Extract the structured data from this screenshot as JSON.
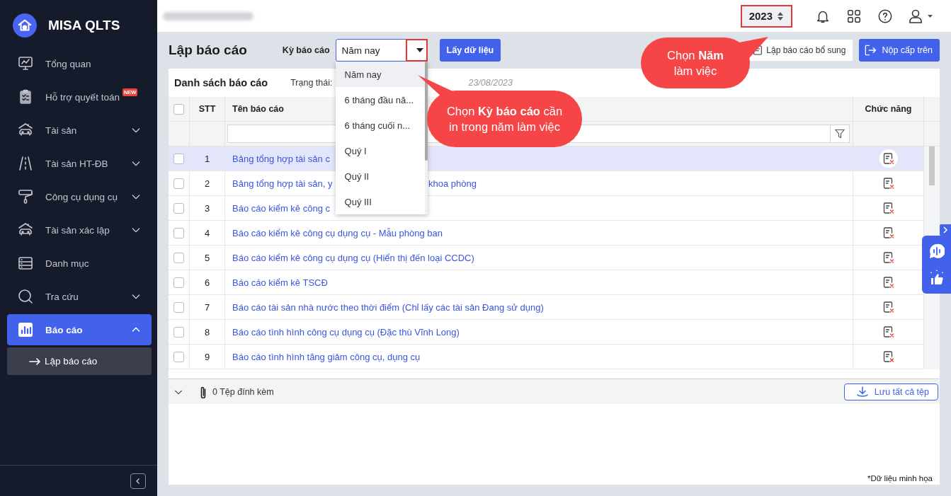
{
  "sidebar": {
    "app_name": "MISA QLTS",
    "items": [
      {
        "label": "Tổng quan",
        "selected": false
      },
      {
        "label": "Hỗ trợ quyết toán",
        "badge": "NEW",
        "selected": false
      },
      {
        "label": "Tài sản",
        "selected": false,
        "expanded": false
      },
      {
        "label": "Tài sản HT-ĐB",
        "selected": false,
        "expanded": false
      },
      {
        "label": "Công cụ dụng cụ",
        "selected": false,
        "expanded": false
      },
      {
        "label": "Tài sản xác lập",
        "selected": false,
        "expanded": false
      },
      {
        "label": "Danh mục",
        "selected": false
      },
      {
        "label": "Tra cứu",
        "selected": false,
        "expanded": false
      },
      {
        "label": "Báo cáo",
        "selected": true,
        "expanded": true,
        "children": [
          {
            "label": "Lập báo cáo",
            "selected": true
          }
        ]
      }
    ]
  },
  "header": {
    "year": "2023"
  },
  "page": {
    "title": "Lập báo cáo",
    "period_label": "Kỳ báo cáo",
    "period_value": "Năm nay",
    "fetch_button": "Lấy dữ liệu",
    "supplement_button": "Lập báo cáo bổ sung",
    "submit_button": "Nộp cấp trên"
  },
  "period_dropdown": {
    "options": [
      {
        "label": "Năm nay",
        "selected": true
      },
      {
        "label": "6 tháng đầu nă...",
        "selected": false
      },
      {
        "label": "6 tháng cuối n...",
        "selected": false
      },
      {
        "label": "Quý I",
        "selected": false
      },
      {
        "label": "Quý II",
        "selected": false
      },
      {
        "label": "Quý III",
        "selected": false
      }
    ]
  },
  "report_list": {
    "title": "Danh sách báo cáo",
    "status_label": "Trạng thái:",
    "date": "23/08/2023",
    "columns": [
      "STT",
      "Tên báo cáo",
      "Chức năng"
    ],
    "header_checked": false,
    "rows": [
      {
        "stt": "1",
        "name": "Bảng tổng hợp tài sản c",
        "checked": false,
        "selected": true
      },
      {
        "stt": "2",
        "name": "Bảng tổng hợp tài sản, y",
        "name_after_overlay": "khoa phòng",
        "checked": false,
        "selected": false
      },
      {
        "stt": "3",
        "name": "Báo cáo kiểm kê công c",
        "checked": false,
        "selected": false
      },
      {
        "stt": "4",
        "name": "Báo cáo kiểm kê công cụ dụng cụ - Mẫu phòng ban",
        "checked": false,
        "selected": false
      },
      {
        "stt": "5",
        "name": "Báo cáo kiểm kê công cụ dụng cụ (Hiển thị đến loại CCDC)",
        "checked": false,
        "selected": false
      },
      {
        "stt": "6",
        "name": "Báo cáo kiểm kê TSCĐ",
        "checked": false,
        "selected": false
      },
      {
        "stt": "7",
        "name": "Báo cáo tài sản nhà nước theo thời điểm (Chỉ lấy các tài sản Đang sử dụng)",
        "checked": false,
        "selected": false
      },
      {
        "stt": "8",
        "name": "Báo cáo tình hình công cụ dụng cụ (Đặc thù Vĩnh Long)",
        "checked": false,
        "selected": false
      },
      {
        "stt": "9",
        "name": "Báo cáo tình hình tăng giảm công cụ, dụng cụ",
        "checked": false,
        "selected": false
      }
    ]
  },
  "attachments": {
    "count_text": "0 Tệp đính kèm",
    "save_button": "Lưu tất cả tệp"
  },
  "note": "*Dữ liệu minh họa",
  "callouts": [
    {
      "text": "Chọn **Kỳ báo cáo** cần\nin trong năm làm việc"
    },
    {
      "text": "Chọn **Năm**\nlàm việc"
    }
  ]
}
